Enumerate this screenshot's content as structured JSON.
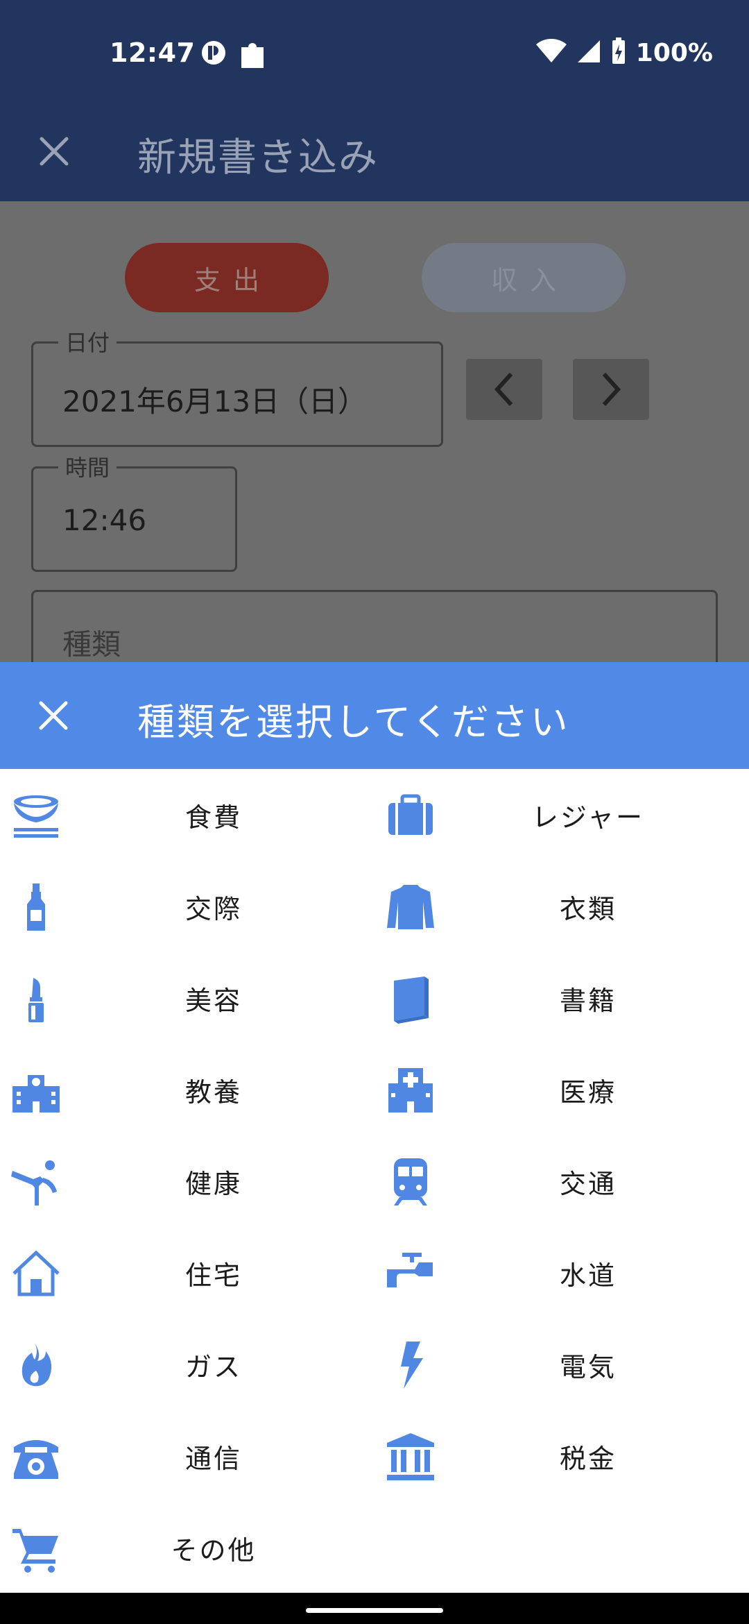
{
  "status": {
    "time": "12:47",
    "battery": "100%"
  },
  "appbar": {
    "title": "新規書き込み"
  },
  "form": {
    "expense_label": "支出",
    "income_label": "収入",
    "date_label": "日付",
    "date_value": "2021年6月13日（日）",
    "time_label": "時間",
    "time_value": "12:46",
    "kind_placeholder": "種類"
  },
  "sheet": {
    "title": "種類を選択してください",
    "categories": [
      {
        "label": "食費",
        "icon": "rice-bowl-icon"
      },
      {
        "label": "レジャー",
        "icon": "suitcase-icon"
      },
      {
        "label": "交際",
        "icon": "bottle-icon"
      },
      {
        "label": "衣類",
        "icon": "shirt-icon"
      },
      {
        "label": "美容",
        "icon": "lipstick-icon"
      },
      {
        "label": "書籍",
        "icon": "book-icon"
      },
      {
        "label": "教養",
        "icon": "school-icon"
      },
      {
        "label": "医療",
        "icon": "hospital-icon"
      },
      {
        "label": "健康",
        "icon": "yoga-icon"
      },
      {
        "label": "交通",
        "icon": "train-icon"
      },
      {
        "label": "住宅",
        "icon": "house-icon"
      },
      {
        "label": "水道",
        "icon": "faucet-icon"
      },
      {
        "label": "ガス",
        "icon": "flame-icon"
      },
      {
        "label": "電気",
        "icon": "lightning-icon"
      },
      {
        "label": "通信",
        "icon": "telephone-icon"
      },
      {
        "label": "税金",
        "icon": "bank-icon"
      },
      {
        "label": "その他",
        "icon": "cart-icon"
      }
    ]
  },
  "colors": {
    "accent": "#518ae6",
    "appbar": "#22355e",
    "expense": "#7a2a22"
  }
}
